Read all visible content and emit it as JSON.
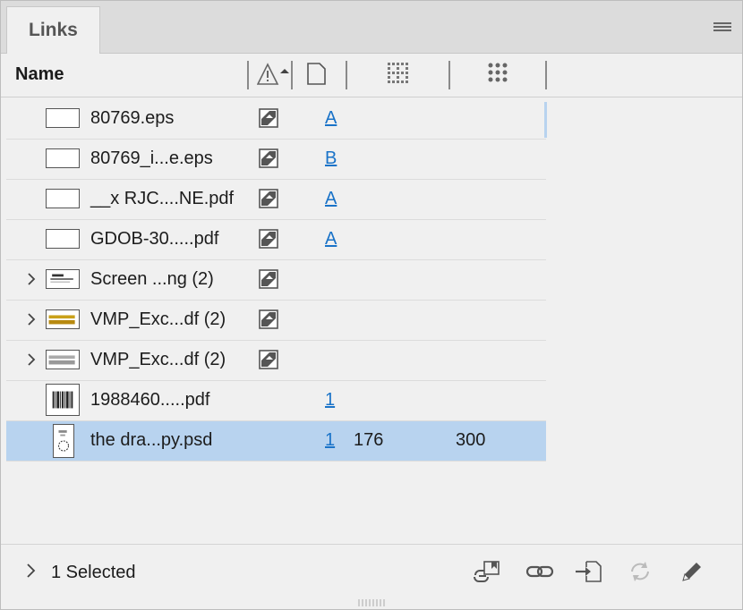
{
  "panel": {
    "tab_label": "Links"
  },
  "header": {
    "name_label": "Name"
  },
  "rows": [
    {
      "name": "80769.eps",
      "page": "A",
      "status": true,
      "caret": false,
      "selected": false
    },
    {
      "name": "80769_i...e.eps",
      "page": "B",
      "status": true,
      "caret": false,
      "selected": false
    },
    {
      "name": "__x RJC....NE.pdf",
      "page": "A",
      "status": true,
      "caret": false,
      "selected": false
    },
    {
      "name": "GDOB-30.....pdf",
      "page": "A",
      "status": true,
      "caret": false,
      "selected": false
    },
    {
      "name": "Screen ...ng (2)",
      "page": "",
      "status": true,
      "caret": true,
      "selected": false
    },
    {
      "name": "VMP_Exc...df (2)",
      "page": "",
      "status": true,
      "caret": true,
      "selected": false
    },
    {
      "name": "VMP_Exc...df (2)",
      "page": "",
      "status": true,
      "caret": true,
      "selected": false
    },
    {
      "name": "1988460.....pdf",
      "page": "1",
      "status": false,
      "caret": false,
      "selected": false
    },
    {
      "name": "the dra...py.psd",
      "page": "1",
      "ppi": "176",
      "effective_ppi": "300",
      "status": false,
      "caret": false,
      "selected": true
    }
  ],
  "footer": {
    "selection_text": "1 Selected"
  },
  "colors": {
    "accent": "#1a73c8",
    "selection": "#b8d3ef"
  }
}
